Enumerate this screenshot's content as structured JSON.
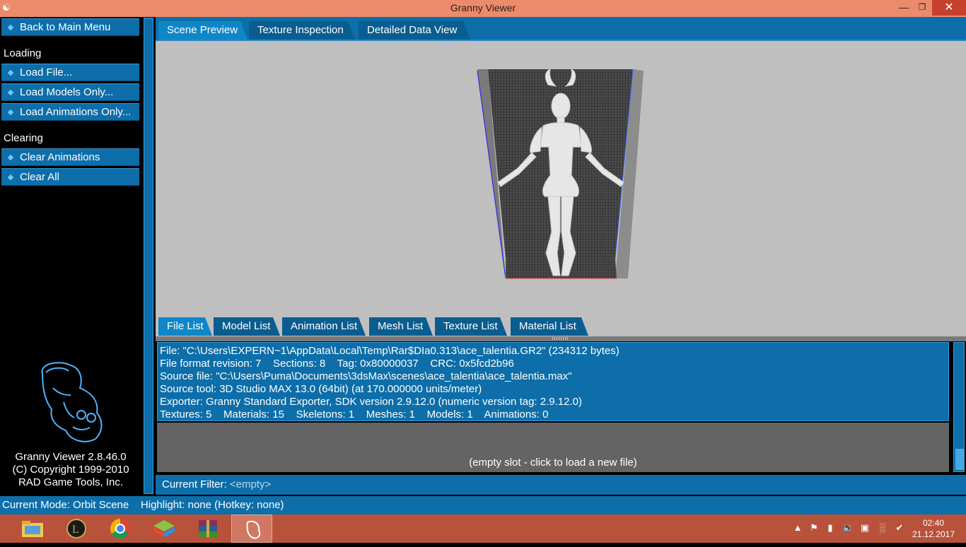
{
  "window": {
    "title": "Granny Viewer",
    "minimize": "—",
    "restore": "❐",
    "close": "✕"
  },
  "left_panel": {
    "back_button": "Back to Main Menu",
    "loading_label": "Loading",
    "loading_items": [
      "Load File...",
      "Load Models Only...",
      "Load Animations Only..."
    ],
    "clearing_label": "Clearing",
    "clearing_items": [
      "Clear Animations",
      "Clear All"
    ],
    "about": [
      "Granny Viewer 2.8.46.0",
      "(C) Copyright 1999-2010",
      "RAD Game Tools, Inc."
    ]
  },
  "top_tabs": [
    "Scene Preview",
    "Texture Inspection",
    "Detailed Data View"
  ],
  "active_top_tab": "Scene Preview",
  "bottom_tabs": [
    "File List",
    "Model List",
    "Animation List",
    "Mesh List",
    "Texture List",
    "Material List"
  ],
  "active_bottom_tab": "File List",
  "file_info": [
    "File: \"C:\\Users\\EXPERN~1\\AppData\\Local\\Temp\\Rar$DIa0.313\\ace_talentia.GR2\" (234312 bytes)",
    "File format revision: 7    Sections: 8    Tag: 0x80000037    CRC: 0x5fcd2b96",
    "Source file: \"C:\\Users\\Puma\\Documents\\3dsMax\\scenes\\ace_talentia\\ace_talentia.max\"",
    "Source tool: 3D Studio MAX 13.0 (64bit) (at 170.000000 units/meter)",
    "Exporter: Granny Standard Exporter, SDK version 2.9.12.0 (numeric version tag: 2.9.12.0)",
    "Textures: 5    Materials: 15    Skeletons: 1    Meshes: 1    Models: 1    Animations: 0"
  ],
  "empty_slot": "(empty slot - click to load a new file)",
  "filter": {
    "label": "Current Filter:",
    "value": "<empty>"
  },
  "status": {
    "mode": "Current Mode: Orbit Scene",
    "highlight": "Highlight: none (Hotkey: none)"
  },
  "taskbar": {
    "apps": [
      "file-explorer-icon",
      "league-of-legends-icon",
      "chrome-icon",
      "bluestacks-icon",
      "winrar-icon",
      "granny-viewer-icon"
    ],
    "clock_time": "02:40",
    "clock_date": "21.12.2017"
  },
  "colors": {
    "accent": "#0d6ea9",
    "titlebar": "#ec8b6c",
    "taskbar": "#b8523a",
    "scene_bg": "#bfbfbf"
  }
}
